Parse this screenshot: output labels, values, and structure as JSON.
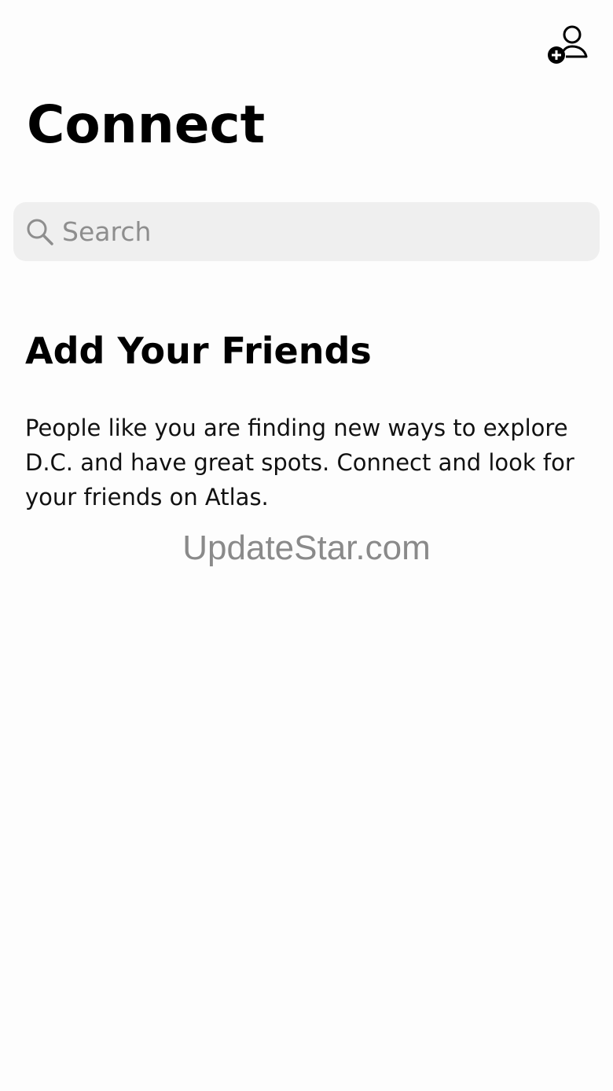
{
  "header": {
    "add_friend_icon": "add-person-icon",
    "title": "Connect"
  },
  "search": {
    "icon": "search-icon",
    "placeholder": "Search",
    "value": ""
  },
  "friends_section": {
    "heading": "Add Your Friends",
    "body": "People like you are finding new ways to explore D.C. and have great spots. Connect and look for your friends on Atlas."
  },
  "watermark": {
    "text": "UpdateStar.com"
  },
  "colors": {
    "background": "#fdfdfd",
    "search_background": "#efefef",
    "placeholder": "#8e8e8e",
    "text": "#000000",
    "watermark": "#8a8a8a"
  }
}
